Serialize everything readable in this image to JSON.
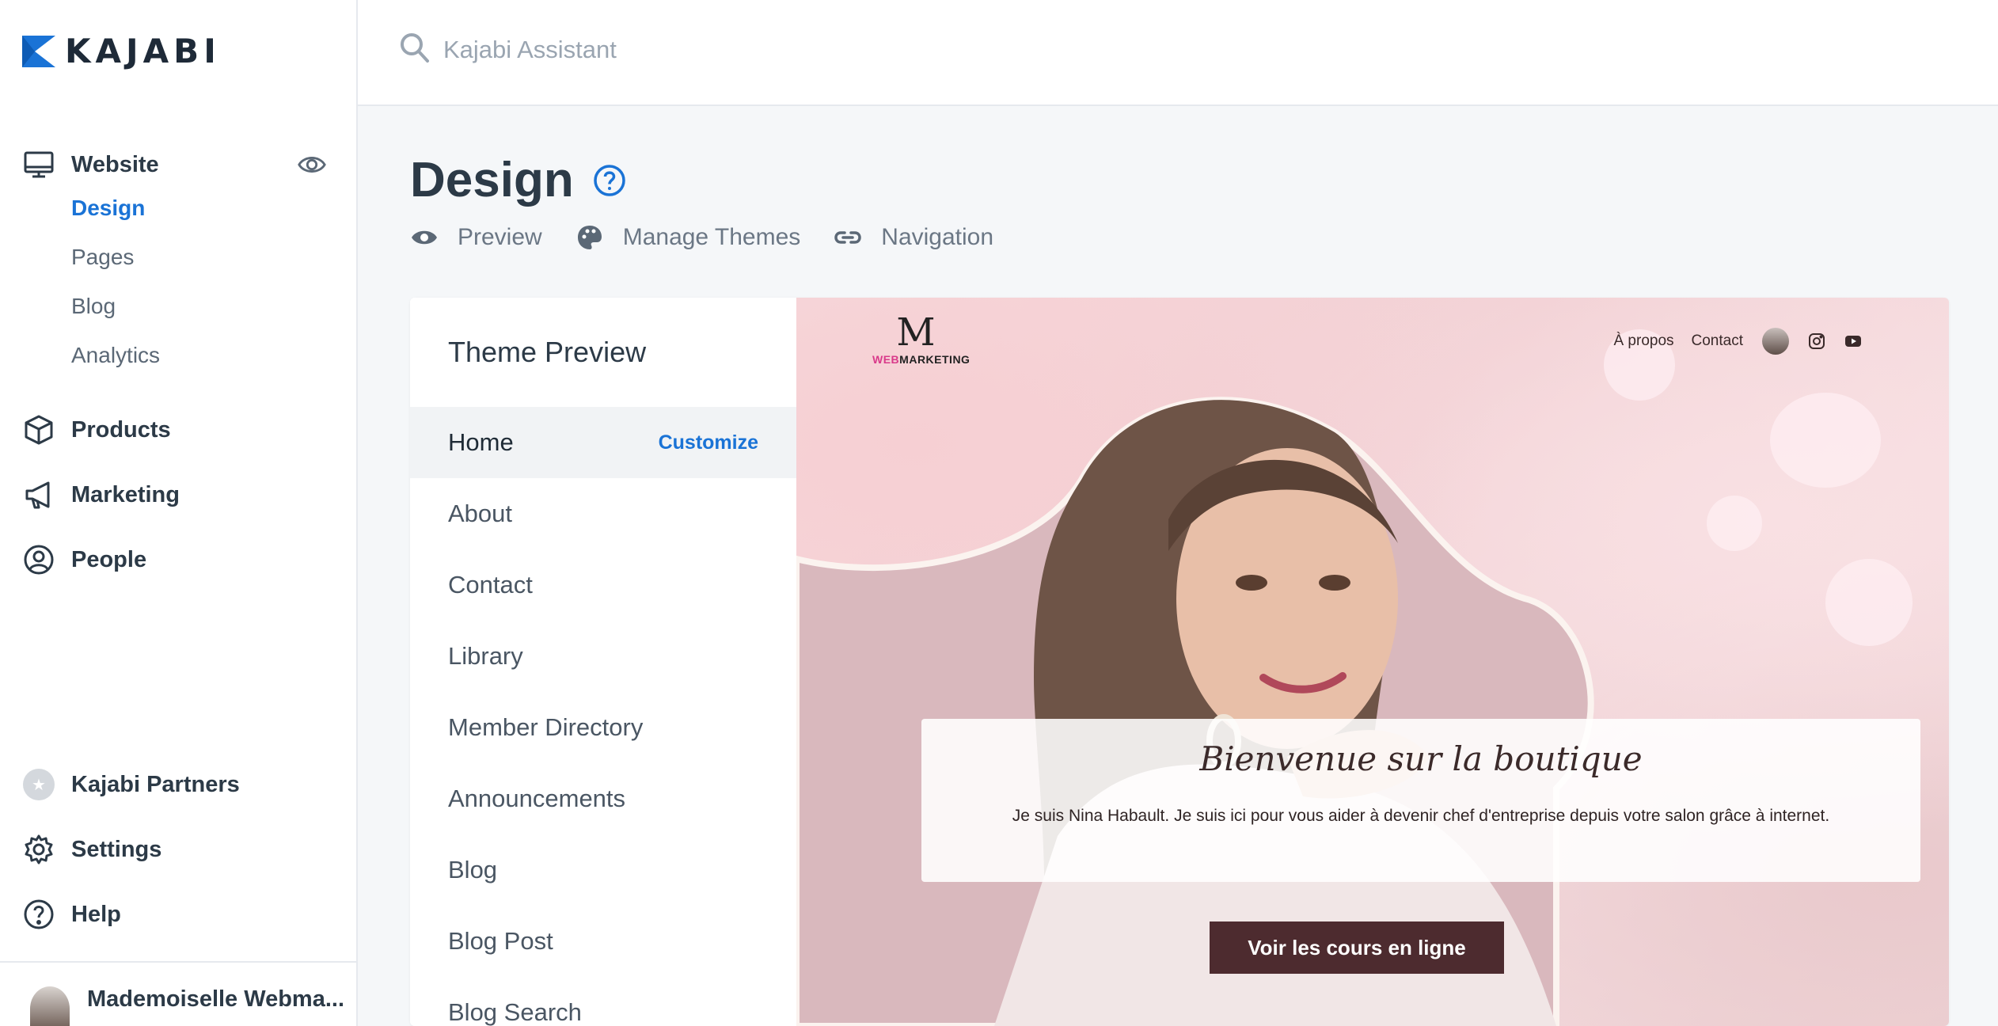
{
  "app": {
    "brand": "KAJABI",
    "brand_color": "#1a73d6"
  },
  "search": {
    "placeholder": "Kajabi Assistant"
  },
  "sidebar": {
    "website": {
      "label": "Website",
      "icon": "monitor-icon"
    },
    "website_subitems": [
      {
        "label": "Design",
        "active": true
      },
      {
        "label": "Pages"
      },
      {
        "label": "Blog"
      },
      {
        "label": "Analytics"
      }
    ],
    "items": [
      {
        "label": "Products",
        "icon": "box-icon"
      },
      {
        "label": "Marketing",
        "icon": "megaphone-icon"
      },
      {
        "label": "People",
        "icon": "user-circle-icon"
      }
    ],
    "bottom_items": [
      {
        "label": "Kajabi Partners",
        "icon": "star-badge-icon"
      },
      {
        "label": "Settings",
        "icon": "gear-icon"
      },
      {
        "label": "Help",
        "icon": "help-circle-icon"
      }
    ],
    "profile": {
      "name": "Mademoiselle Webma..."
    }
  },
  "main": {
    "title": "Design",
    "tabs": [
      {
        "label": "Preview",
        "icon": "eye-icon"
      },
      {
        "label": "Manage Themes",
        "icon": "palette-icon"
      },
      {
        "label": "Navigation",
        "icon": "link-icon"
      }
    ],
    "theme_preview": {
      "heading": "Theme Preview",
      "customize_label": "Customize",
      "pages": [
        "Home",
        "About",
        "Contact",
        "Library",
        "Member Directory",
        "Announcements",
        "Blog",
        "Blog Post",
        "Blog Search"
      ],
      "active_page": "Home"
    }
  },
  "site_preview": {
    "logo_m": "M",
    "logo_web": "WEB",
    "logo_marketing": "MARKETING",
    "nav_links": [
      "À propos",
      "Contact"
    ],
    "welcome_title": "Bienvenue sur la boutique",
    "welcome_text": "Je suis Nina Habault.  Je suis ici pour vous aider à devenir chef d'entreprise  depuis votre salon grâce à internet.",
    "cta_label": "Voir les cours en ligne"
  }
}
